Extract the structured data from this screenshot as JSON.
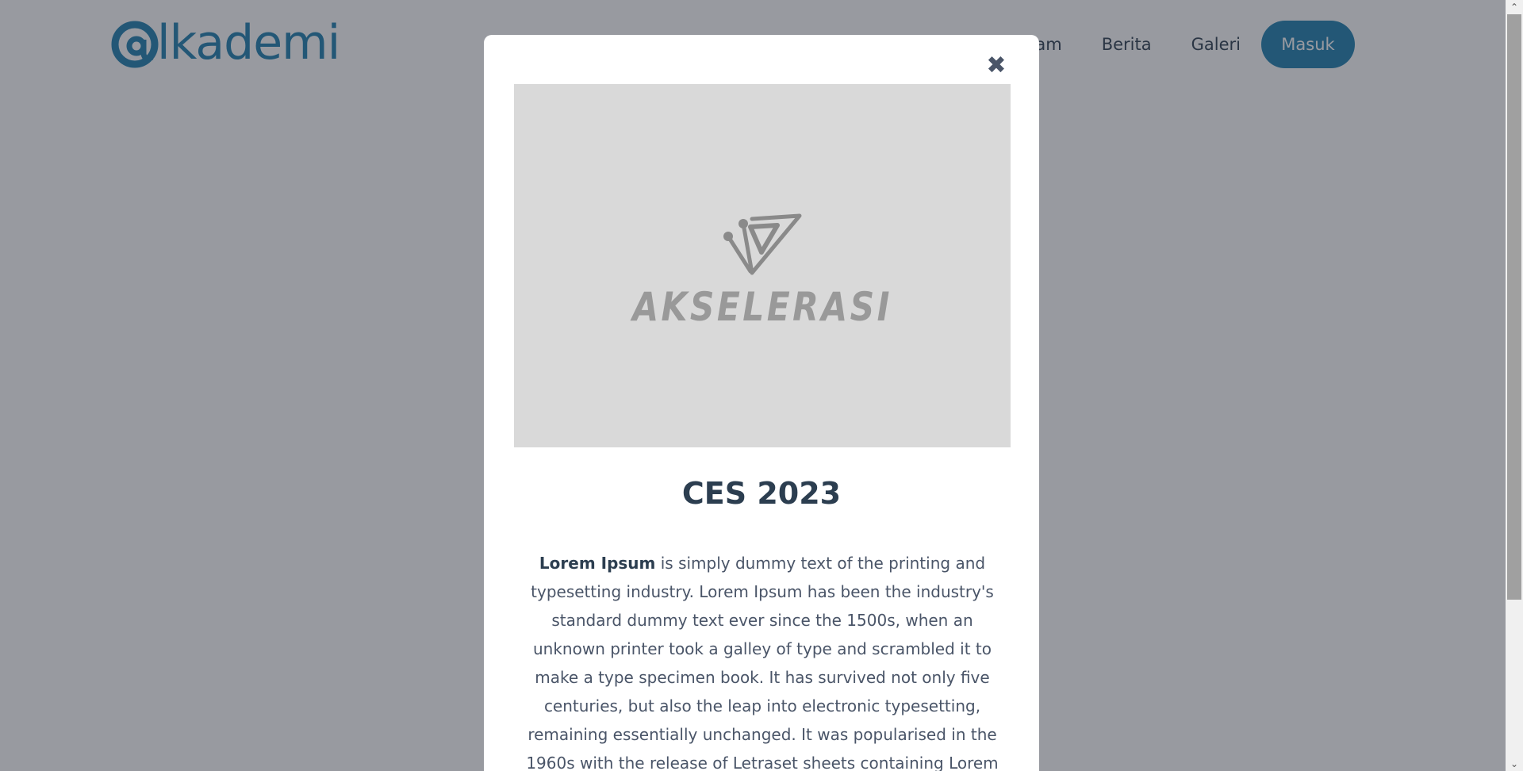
{
  "header": {
    "logo_text": "lkademi",
    "nav": [
      {
        "label": "ogram"
      },
      {
        "label": "Berita"
      },
      {
        "label": "Galeri"
      }
    ],
    "login_label": "Masuk"
  },
  "modal": {
    "close_glyph": "✖",
    "image_brand": "AKSELERASI",
    "title": "CES 2023",
    "body_bold": "Lorem Ipsum",
    "body_text": " is simply dummy text of the printing and typesetting industry. Lorem Ipsum has been the industry's standard dummy text ever since the 1500s, when an unknown printer took a galley of type and scrambled it to make a type specimen book. It has survived not only five centuries, but also the leap into electronic typesetting, remaining essentially unchanged. It was popularised in the 1960s with the release of Letraset sheets containing Lorem Ipsum passages, and more recently with desktop publishing"
  },
  "scrollbar": {
    "up_glyph": "⌃",
    "down_glyph": "⌄"
  },
  "colors": {
    "brand": "#1f7fae",
    "overlay": "rgba(40, 44, 56, 0.48)",
    "text_dark": "#2c3e50",
    "image_placeholder": "#d9d9d9"
  },
  "icons": {
    "logo_mark": "at-sign-logo-icon",
    "close": "close-icon",
    "brand_mark": "akselerasi-logo-icon"
  }
}
